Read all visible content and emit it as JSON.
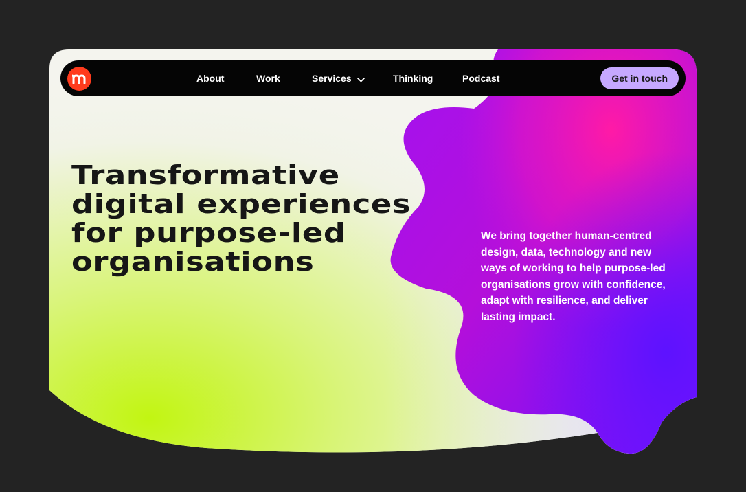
{
  "nav": {
    "logo_icon": "m-logo-icon",
    "links": [
      {
        "label": "About"
      },
      {
        "label": "Work"
      },
      {
        "label": "Services",
        "icon": "chevron-down-icon"
      },
      {
        "label": "Thinking"
      },
      {
        "label": "Podcast"
      }
    ],
    "cta_label": "Get in touch"
  },
  "hero": {
    "headline_lines": [
      "Transformative",
      "digital experiences",
      "for purpose-led",
      "organisations"
    ],
    "intro": "We bring together human-centred design, data, technology and new ways of working to help purpose-led organisations grow with confidence, adapt with resilience, and deliver lasting impact."
  },
  "colors": {
    "page_background": "#232323",
    "nav_background": "#050505",
    "logo": "#ff3b1d",
    "cta": "#c6a8ff",
    "lime": "#c2f512",
    "magenta": "#ff1aa6",
    "violet": "#6b12ff",
    "purple": "#b012e0"
  }
}
